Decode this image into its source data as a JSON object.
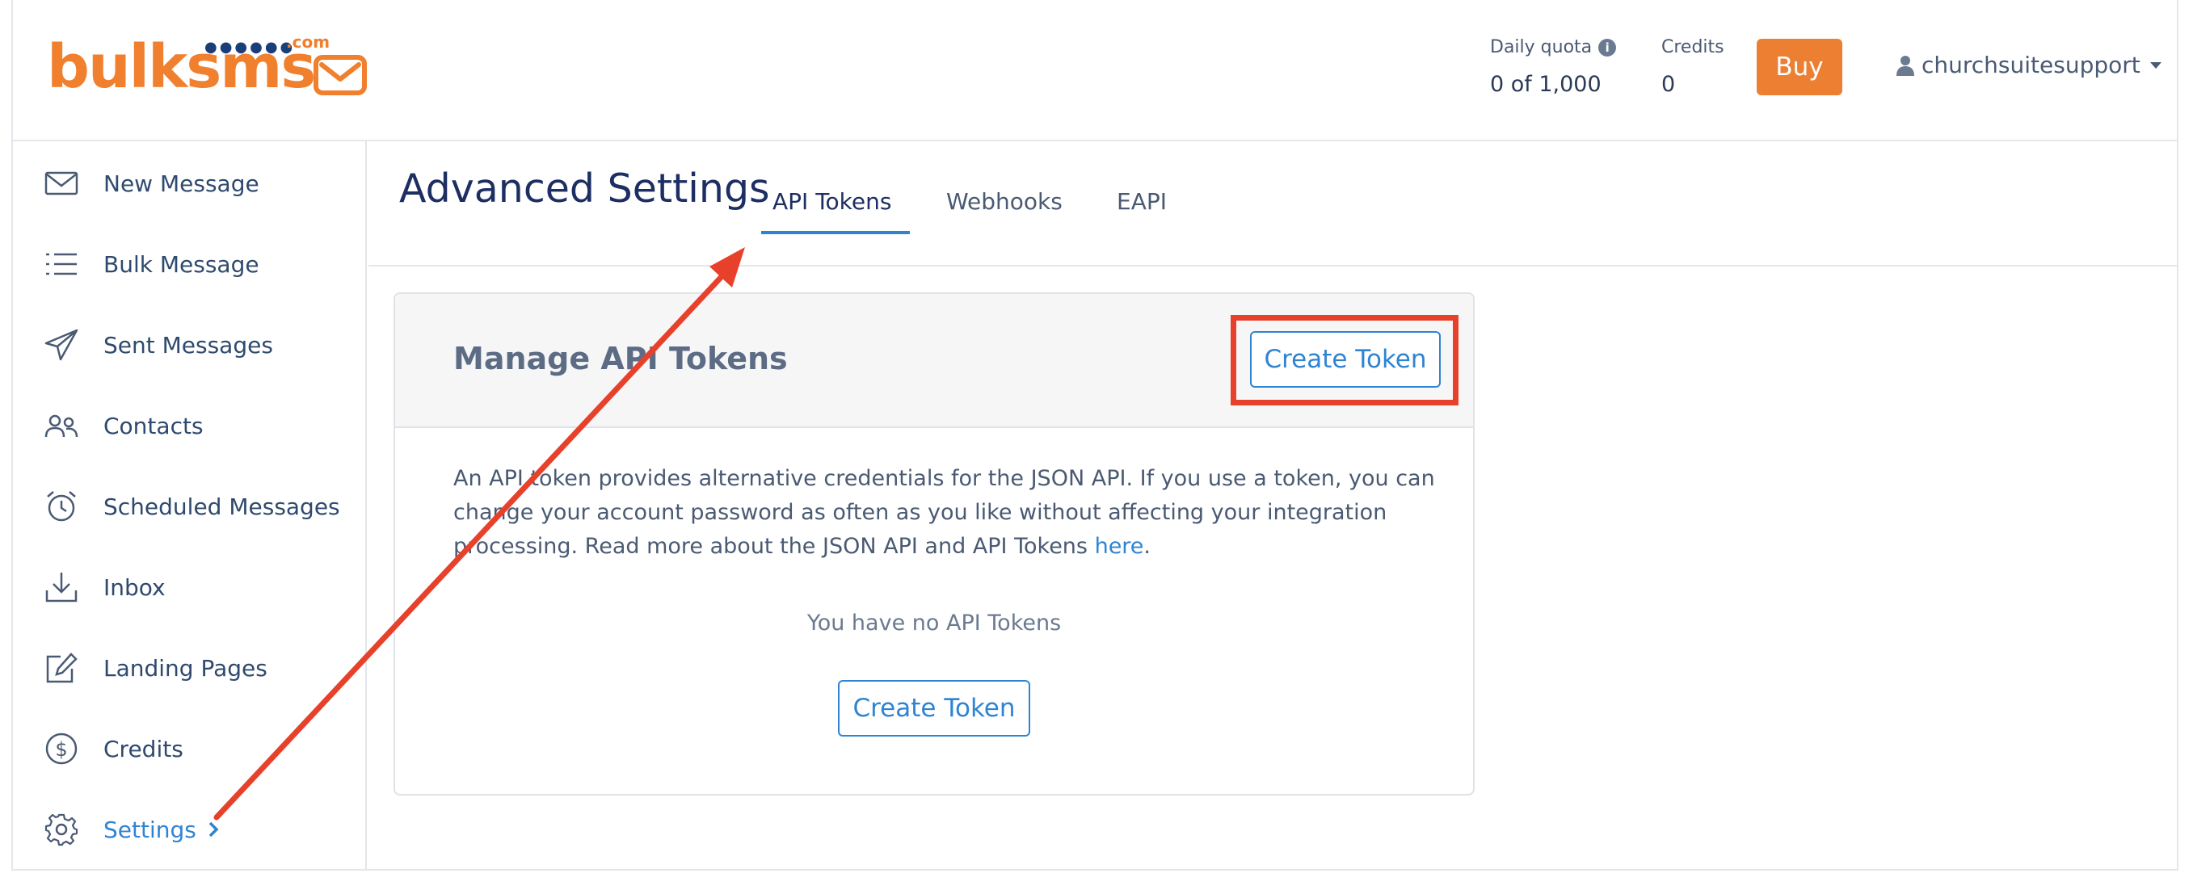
{
  "brand": {
    "name": "bulksms",
    "domain_suffix": ".com",
    "accent": "#ec7f32",
    "navy": "#1b3d7a"
  },
  "header": {
    "daily_quota_label": "Daily quota",
    "daily_quota_value": "0 of 1,000",
    "credits_label": "Credits",
    "credits_value": "0",
    "buy_label": "Buy",
    "username": "churchsuitesupport"
  },
  "sidebar": {
    "items": [
      {
        "label": "New Message",
        "icon": "envelope-icon"
      },
      {
        "label": "Bulk Message",
        "icon": "list-icon"
      },
      {
        "label": "Sent Messages",
        "icon": "paper-plane-icon"
      },
      {
        "label": "Contacts",
        "icon": "users-icon"
      },
      {
        "label": "Scheduled Messages",
        "icon": "alarm-clock-icon"
      },
      {
        "label": "Inbox",
        "icon": "download-icon"
      },
      {
        "label": "Landing Pages",
        "icon": "edit-icon"
      },
      {
        "label": "Credits",
        "icon": "dollar-circle-icon"
      },
      {
        "label": "Settings",
        "icon": "gear-icon",
        "active": true
      }
    ]
  },
  "page": {
    "title": "Advanced Settings",
    "tabs": [
      {
        "label": "API Tokens",
        "active": true
      },
      {
        "label": "Webhooks"
      },
      {
        "label": "EAPI"
      }
    ]
  },
  "card": {
    "title": "Manage API Tokens",
    "create_label": "Create Token",
    "body_text": "An API token provides alternative credentials for the JSON API. If you use a token, you can change your account password as often as you like without affecting your integration processing. Read more about the JSON API and API Tokens ",
    "link_text": "here",
    "body_end": ".",
    "empty_message": "You have no API Tokens",
    "create_label_bottom": "Create Token"
  },
  "colors": {
    "link": "#2f84d2",
    "annotation": "#e8412b",
    "title": "#1d2f62"
  }
}
